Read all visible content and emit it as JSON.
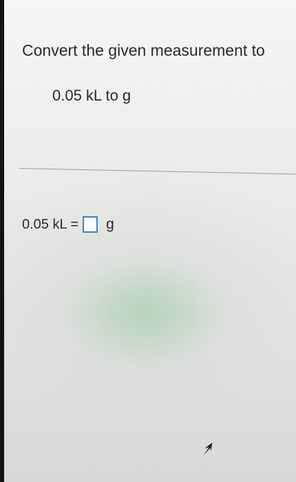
{
  "question": {
    "title": "Convert the given measurement to",
    "prompt": "0.05 kL to g"
  },
  "answer": {
    "lhs": "0.05 kL =",
    "input_value": "",
    "unit": "g"
  },
  "colors": {
    "input_border": "#4a7fb5",
    "text": "#2a2a2a",
    "divider": "#9a9a9a"
  },
  "icons": {
    "cursor": "mouse-pointer-icon"
  }
}
